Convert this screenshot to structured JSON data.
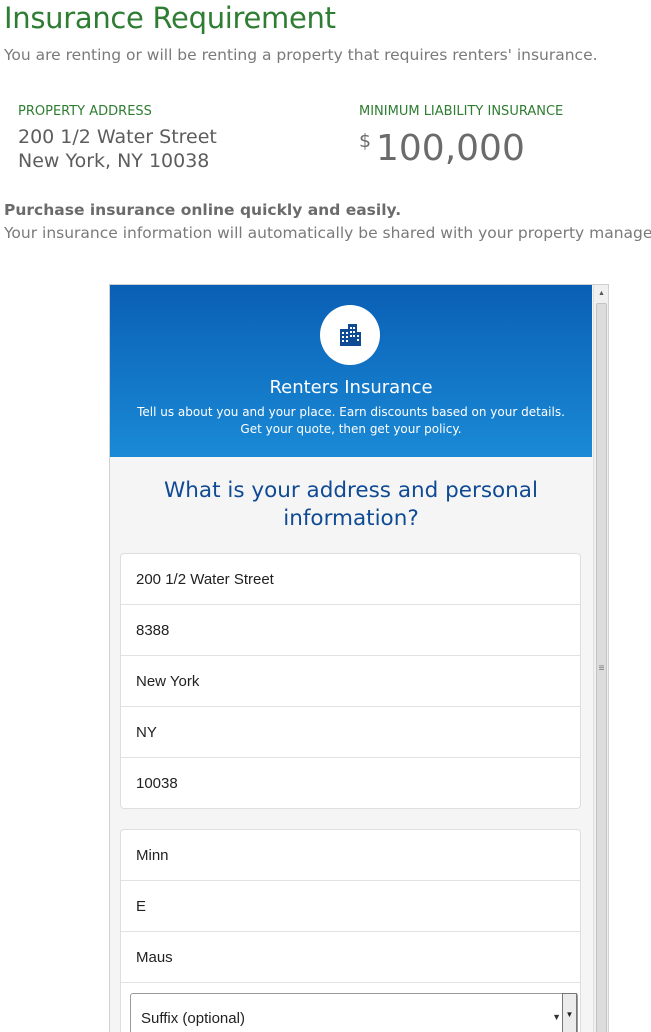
{
  "header": {
    "title": "Insurance Requirement",
    "subtitle": "You are renting or will be renting a property that requires renters' insurance."
  },
  "property": {
    "address_label": "PROPERTY ADDRESS",
    "address_line1": "200 1/2 Water Street",
    "address_line2": "New York, NY 10038",
    "min_label": "MINIMUM LIABILITY INSURANCE",
    "currency": "$",
    "amount": "100,000"
  },
  "purchase": {
    "bold": "Purchase insurance online quickly and easily.",
    "desc": "Your insurance information will automatically be shared with your property manager."
  },
  "widget": {
    "hero_icon": "building-icon",
    "hero_title": "Renters Insurance",
    "hero_text1": "Tell us about you and your place. Earn discounts based on your details.",
    "hero_text2": "Get your quote, then get your policy.",
    "question": "What is your address and personal information?",
    "address_fields": [
      "200 1/2 Water Street",
      "8388",
      "New York",
      "NY",
      "10038"
    ],
    "name_fields": [
      "Minn",
      "E",
      "Maus"
    ],
    "suffix_select": "Suffix (optional)"
  },
  "colors": {
    "title_green": "#2e7d32",
    "hero_blue_top": "#0a5fb4",
    "hero_blue_bottom": "#1a8ad6",
    "question_blue": "#0f4a94"
  }
}
